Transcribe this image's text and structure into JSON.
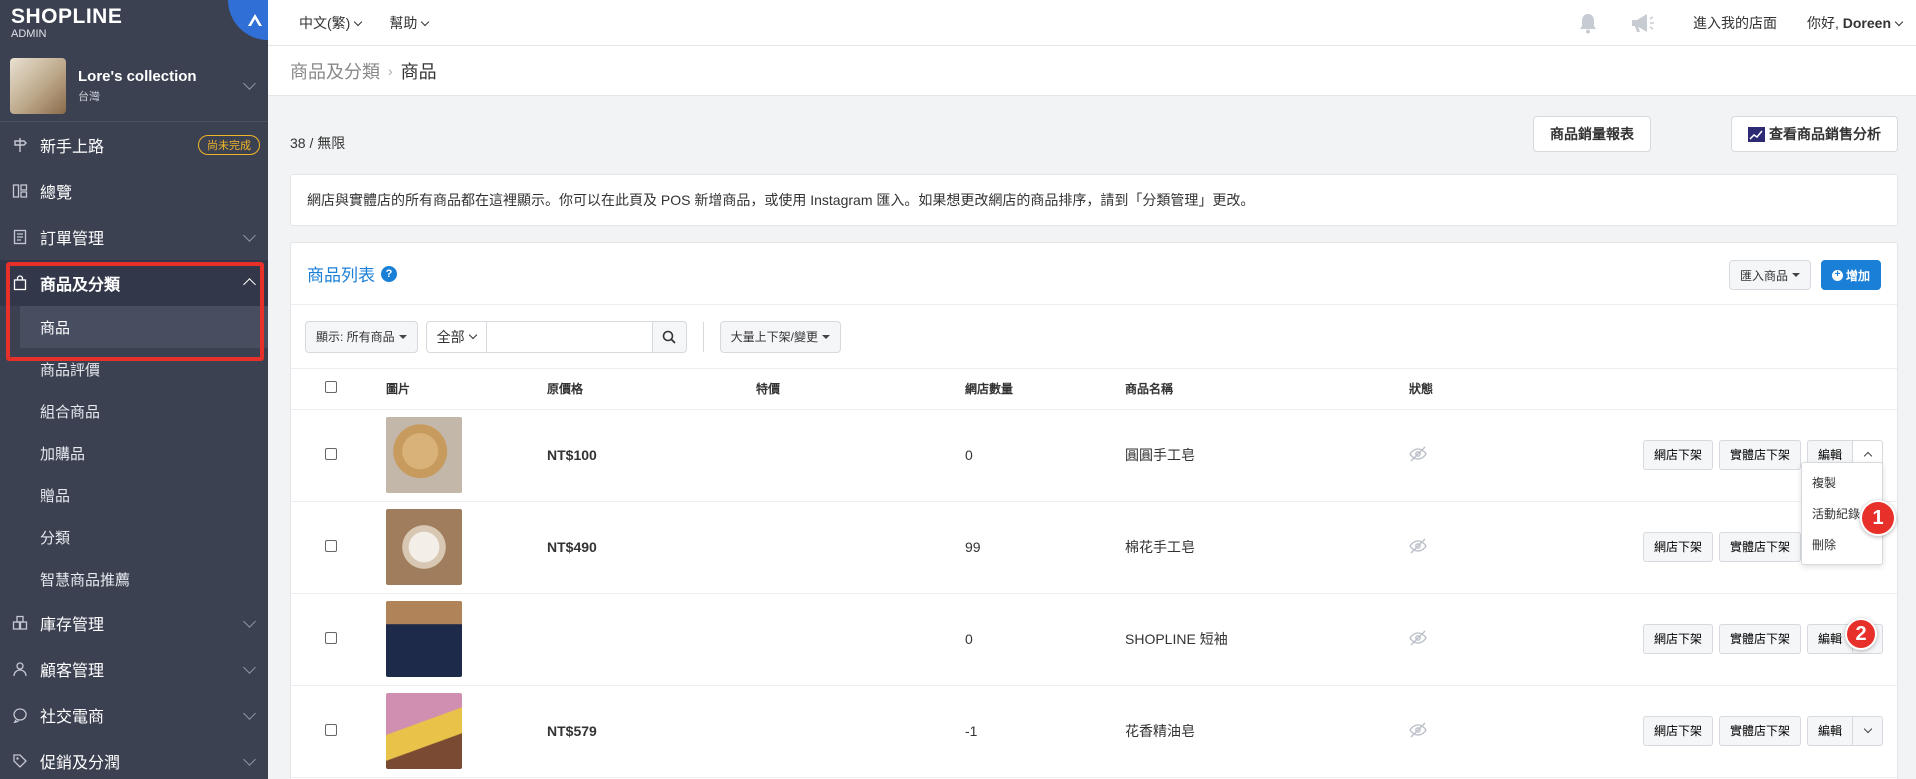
{
  "sidebar": {
    "logo_text": "SHOPLINE",
    "logo_sub": "ADMIN",
    "store_name": "Lore's collection",
    "store_region": "台灣",
    "onboarding": {
      "label": "新手上路",
      "badge": "尚未完成"
    },
    "items": [
      {
        "label": "總覽"
      },
      {
        "label": "訂單管理"
      },
      {
        "label": "商品及分類"
      },
      {
        "label": "庫存管理"
      },
      {
        "label": "顧客管理"
      },
      {
        "label": "社交電商"
      },
      {
        "label": "促銷及分潤"
      }
    ],
    "sub_items": [
      "商品",
      "商品評價",
      "組合商品",
      "加購品",
      "贈品",
      "分類",
      "智慧商品推薦"
    ]
  },
  "topbar": {
    "language": "中文(繁)",
    "help": "幫助",
    "store_link": "進入我的店面",
    "greeting": "你好,",
    "user": "Doreen"
  },
  "breadcrumb": {
    "parent": "商品及分類",
    "current": "商品"
  },
  "summary": {
    "count": "38 / 無限",
    "report_button": "商品銷量報表",
    "analysis_button": "查看商品銷售分析"
  },
  "notice": "網店與實體店的所有商品都在這裡顯示。你可以在此頁及 POS 新增商品，或使用 Instagram 匯入。如果想更改網店的商品排序，請到「分類管理」更改。",
  "panel": {
    "title": "商品列表",
    "help_glyph": "?",
    "import_button": "匯入商品",
    "add_button": "增加",
    "filter_button": "顯示: 所有商品",
    "scope_select": "全部",
    "search_value": "",
    "bulk_button": "大量上下架/變更"
  },
  "table": {
    "headers": [
      "圖片",
      "原價格",
      "特價",
      "網店數量",
      "商品名稱",
      "狀態"
    ],
    "rows": [
      {
        "price": "NT$100",
        "special": "",
        "qty": "0",
        "name": "圓圓手工皂"
      },
      {
        "price": "NT$490",
        "special": "",
        "qty": "99",
        "name": "棉花手工皂"
      },
      {
        "price": "",
        "special": "",
        "qty": "0",
        "name": "SHOPLINE 短袖"
      },
      {
        "price": "NT$579",
        "special": "",
        "qty": "-1",
        "name": "花香精油皂"
      }
    ],
    "row_actions": {
      "online_unpublish": "網店下架",
      "store_unpublish": "實體店下架",
      "edit": "編輯"
    }
  },
  "dropdown": {
    "items": [
      "複製",
      "活動紀錄",
      "刪除"
    ]
  },
  "markers": [
    "1",
    "2"
  ],
  "colors": {
    "sidebar_bg": "#3b4150",
    "accent": "#1a7fd6",
    "highlight": "#e8302a",
    "badge": "#f0b429"
  }
}
